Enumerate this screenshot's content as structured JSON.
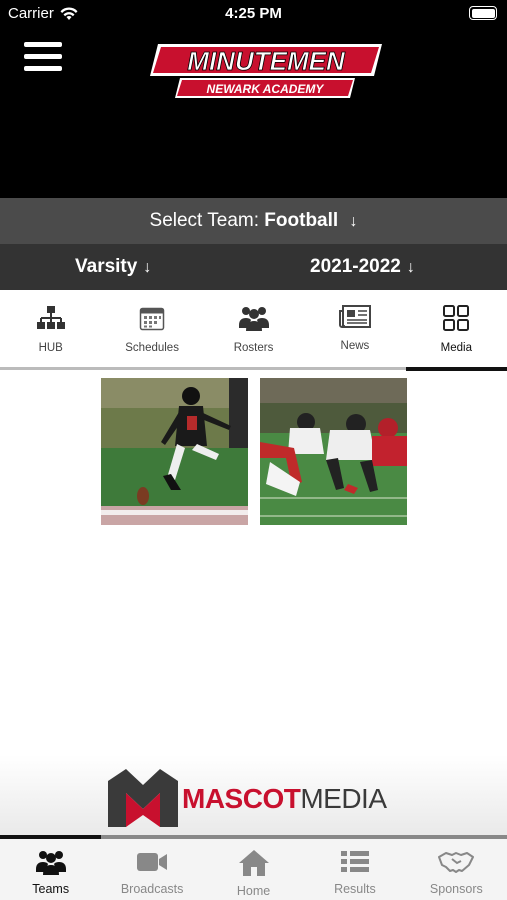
{
  "status_bar": {
    "carrier": "Carrier",
    "time": "4:25 PM"
  },
  "header": {
    "logo_title": "MINUTEMEN",
    "logo_subtitle": "NEWARK ACADEMY"
  },
  "team_selector": {
    "prefix": "Select Team:",
    "team": "Football"
  },
  "level_selector": {
    "level": "Varsity",
    "season": "2021-2022"
  },
  "tabs": [
    {
      "label": "HUB",
      "icon": "hierarchy-icon"
    },
    {
      "label": "Schedules",
      "icon": "calendar-icon"
    },
    {
      "label": "Rosters",
      "icon": "people-icon"
    },
    {
      "label": "News",
      "icon": "newspaper-icon"
    },
    {
      "label": "Media",
      "icon": "grid-icon",
      "active": true
    }
  ],
  "media": {
    "items": [
      {
        "icon": "photo-kicker"
      },
      {
        "icon": "photo-linemen"
      }
    ]
  },
  "sponsor": {
    "name_part1": "MASCOT",
    "name_part2": "MEDIA"
  },
  "bottom_nav": [
    {
      "label": "Teams",
      "icon": "people-icon",
      "active": true
    },
    {
      "label": "Broadcasts",
      "icon": "video-icon"
    },
    {
      "label": "Home",
      "icon": "home-icon"
    },
    {
      "label": "Results",
      "icon": "list-icon"
    },
    {
      "label": "Sponsors",
      "icon": "handshake-icon"
    }
  ],
  "colors": {
    "brand_red": "#c8102e",
    "header_bg": "#000000",
    "team_bar": "#4b4b4b",
    "level_bar": "#333333"
  },
  "carousel": {
    "position": 0.2
  }
}
